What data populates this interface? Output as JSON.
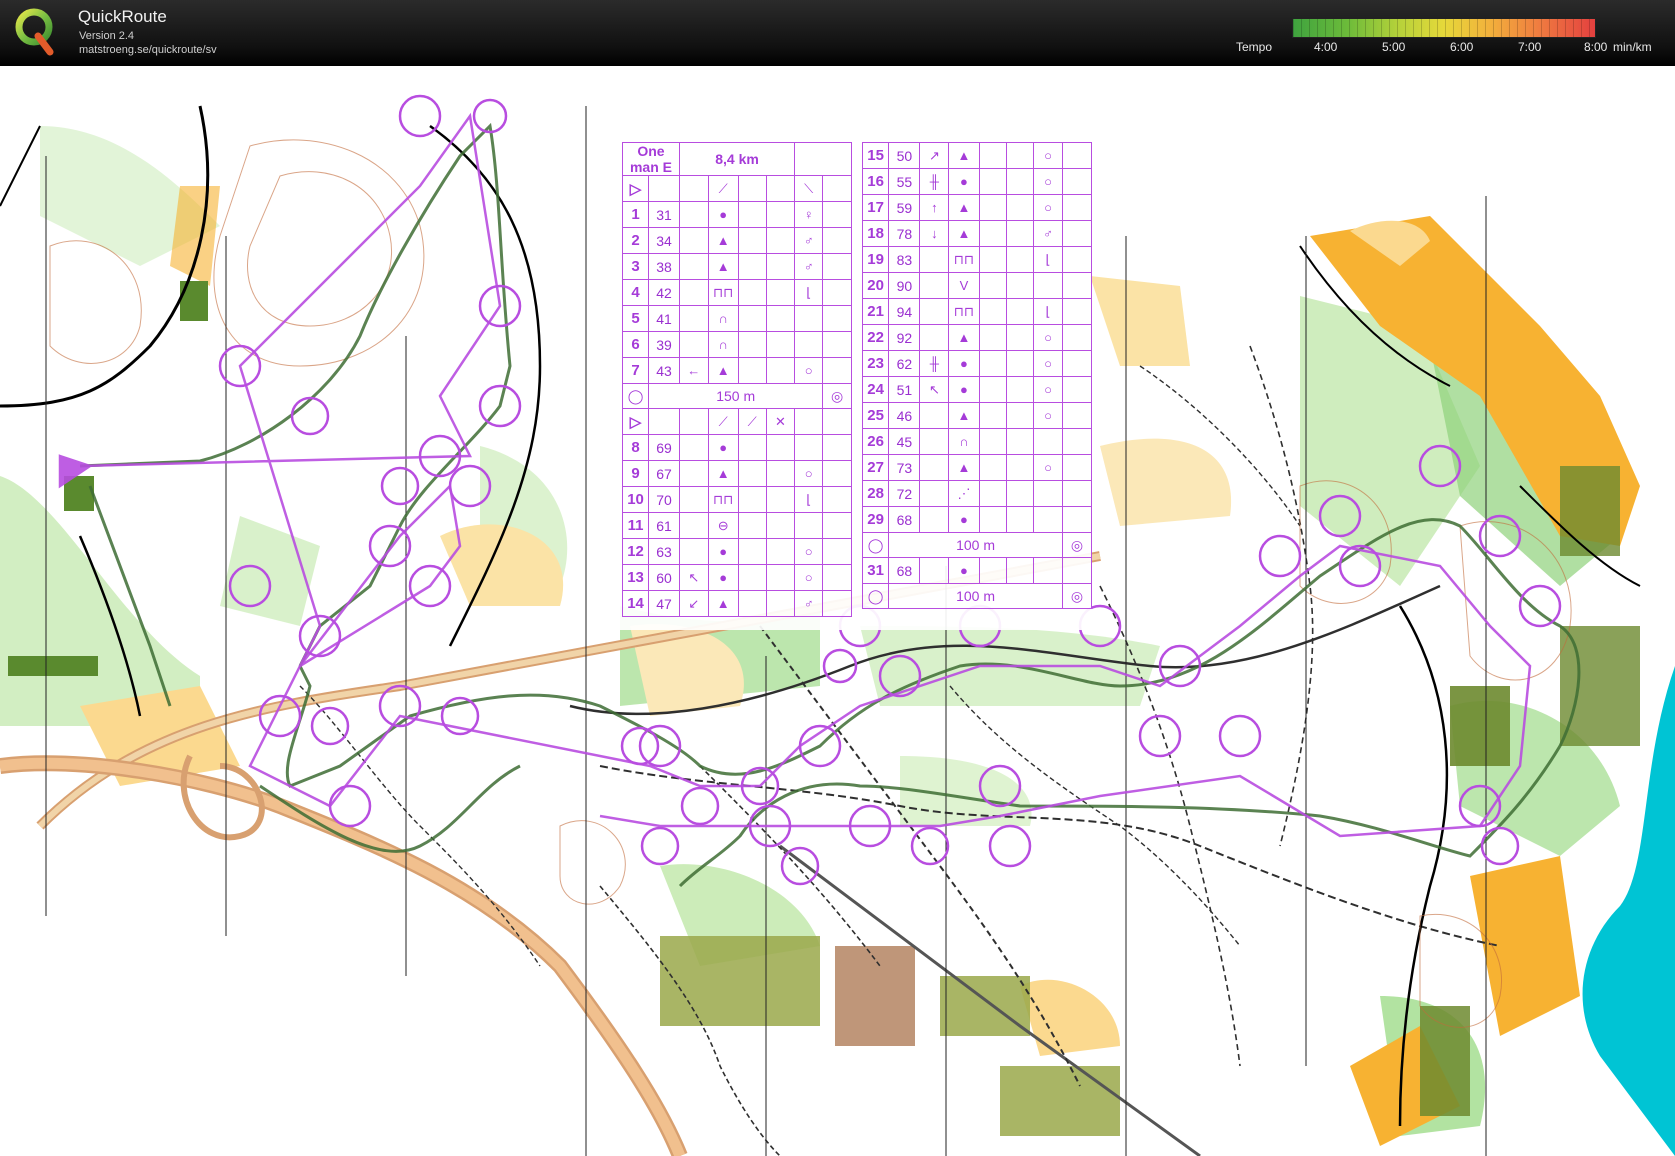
{
  "app": {
    "title": "QuickRoute",
    "version": "Version 2.4",
    "url": "matstroeng.se/quickroute/sv"
  },
  "legend": {
    "label": "Tempo",
    "ticks": [
      "4:00",
      "5:00",
      "6:00",
      "7:00",
      "8:00"
    ],
    "unit": "min/km",
    "colors": [
      "#3fa33f",
      "#b6d23a",
      "#e6d83a",
      "#f2b13c",
      "#e3403f"
    ]
  },
  "course": {
    "name": "One man E",
    "length": "8,4 km",
    "colors": {
      "course": "#b84de0",
      "route": "#2f6b2f",
      "water": "#00c4d4",
      "open": "#f7b232",
      "forest_green": "#8fd27a"
    }
  },
  "controls_left": [
    {
      "n": "1",
      "code": "31",
      "c1": "",
      "c2": "●",
      "c3": "",
      "c4": "",
      "c5": "♀",
      "c6": ""
    },
    {
      "n": "2",
      "code": "34",
      "c1": "",
      "c2": "▲",
      "c3": "",
      "c4": "",
      "c5": "♂",
      "c6": ""
    },
    {
      "n": "3",
      "code": "38",
      "c1": "",
      "c2": "▲",
      "c3": "",
      "c4": "",
      "c5": "♂",
      "c6": ""
    },
    {
      "n": "4",
      "code": "42",
      "c1": "",
      "c2": "⊓⊓",
      "c3": "",
      "c4": "",
      "c5": "⌊",
      "c6": ""
    },
    {
      "n": "5",
      "code": "41",
      "c1": "",
      "c2": "∩",
      "c3": "",
      "c4": "",
      "c5": "",
      "c6": ""
    },
    {
      "n": "6",
      "code": "39",
      "c1": "",
      "c2": "∩",
      "c3": "",
      "c4": "",
      "c5": "",
      "c6": ""
    },
    {
      "n": "7",
      "code": "43",
      "c1": "←",
      "c2": "▲",
      "c3": "",
      "c4": "",
      "c5": "○",
      "c6": ""
    }
  ],
  "dist_a": "150 m",
  "controls_left_b": [
    {
      "n": "8",
      "code": "69",
      "c1": "",
      "c2": "●",
      "c3": "",
      "c4": "",
      "c5": "",
      "c6": ""
    },
    {
      "n": "9",
      "code": "67",
      "c1": "",
      "c2": "▲",
      "c3": "",
      "c4": "",
      "c5": "○",
      "c6": ""
    },
    {
      "n": "10",
      "code": "70",
      "c1": "",
      "c2": "⊓⊓",
      "c3": "",
      "c4": "",
      "c5": "⌊",
      "c6": ""
    },
    {
      "n": "11",
      "code": "61",
      "c1": "",
      "c2": "⊖",
      "c3": "",
      "c4": "",
      "c5": "",
      "c6": ""
    },
    {
      "n": "12",
      "code": "63",
      "c1": "",
      "c2": "●",
      "c3": "",
      "c4": "",
      "c5": "○",
      "c6": ""
    },
    {
      "n": "13",
      "code": "60",
      "c1": "↖",
      "c2": "●",
      "c3": "",
      "c4": "",
      "c5": "○",
      "c6": ""
    },
    {
      "n": "14",
      "code": "47",
      "c1": "↙",
      "c2": "▲",
      "c3": "",
      "c4": "",
      "c5": "♂",
      "c6": ""
    }
  ],
  "controls_right": [
    {
      "n": "15",
      "code": "50",
      "c1": "↗",
      "c2": "▲",
      "c3": "",
      "c4": "",
      "c5": "○",
      "c6": ""
    },
    {
      "n": "16",
      "code": "55",
      "c1": "╫",
      "c2": "●",
      "c3": "",
      "c4": "",
      "c5": "○",
      "c6": ""
    },
    {
      "n": "17",
      "code": "59",
      "c1": "↑",
      "c2": "▲",
      "c3": "",
      "c4": "",
      "c5": "○",
      "c6": ""
    },
    {
      "n": "18",
      "code": "78",
      "c1": "↓",
      "c2": "▲",
      "c3": "",
      "c4": "",
      "c5": "♂",
      "c6": ""
    },
    {
      "n": "19",
      "code": "83",
      "c1": "",
      "c2": "⊓⊓",
      "c3": "",
      "c4": "",
      "c5": "⌊",
      "c6": ""
    },
    {
      "n": "20",
      "code": "90",
      "c1": "",
      "c2": "V",
      "c3": "",
      "c4": "",
      "c5": "",
      "c6": ""
    },
    {
      "n": "21",
      "code": "94",
      "c1": "",
      "c2": "⊓⊓",
      "c3": "",
      "c4": "",
      "c5": "⌊",
      "c6": ""
    },
    {
      "n": "22",
      "code": "92",
      "c1": "",
      "c2": "▲",
      "c3": "",
      "c4": "",
      "c5": "○",
      "c6": ""
    },
    {
      "n": "23",
      "code": "62",
      "c1": "╫",
      "c2": "●",
      "c3": "",
      "c4": "",
      "c5": "○",
      "c6": ""
    },
    {
      "n": "24",
      "code": "51",
      "c1": "↖",
      "c2": "●",
      "c3": "",
      "c4": "",
      "c5": "○",
      "c6": ""
    },
    {
      "n": "25",
      "code": "46",
      "c1": "",
      "c2": "▲",
      "c3": "",
      "c4": "",
      "c5": "○",
      "c6": ""
    },
    {
      "n": "26",
      "code": "45",
      "c1": "",
      "c2": "∩",
      "c3": "",
      "c4": "",
      "c5": "",
      "c6": ""
    },
    {
      "n": "27",
      "code": "73",
      "c1": "",
      "c2": "▲",
      "c3": "",
      "c4": "",
      "c5": "○",
      "c6": ""
    },
    {
      "n": "28",
      "code": "72",
      "c1": "",
      "c2": "⋰",
      "c3": "",
      "c4": "",
      "c5": "",
      "c6": ""
    },
    {
      "n": "29",
      "code": "68",
      "c1": "",
      "c2": "●",
      "c3": "",
      "c4": "",
      "c5": "",
      "c6": ""
    }
  ],
  "dist_b": "100 m",
  "control_31": {
    "n": "31",
    "code": "68",
    "c2": "●"
  },
  "dist_c": "100 m"
}
